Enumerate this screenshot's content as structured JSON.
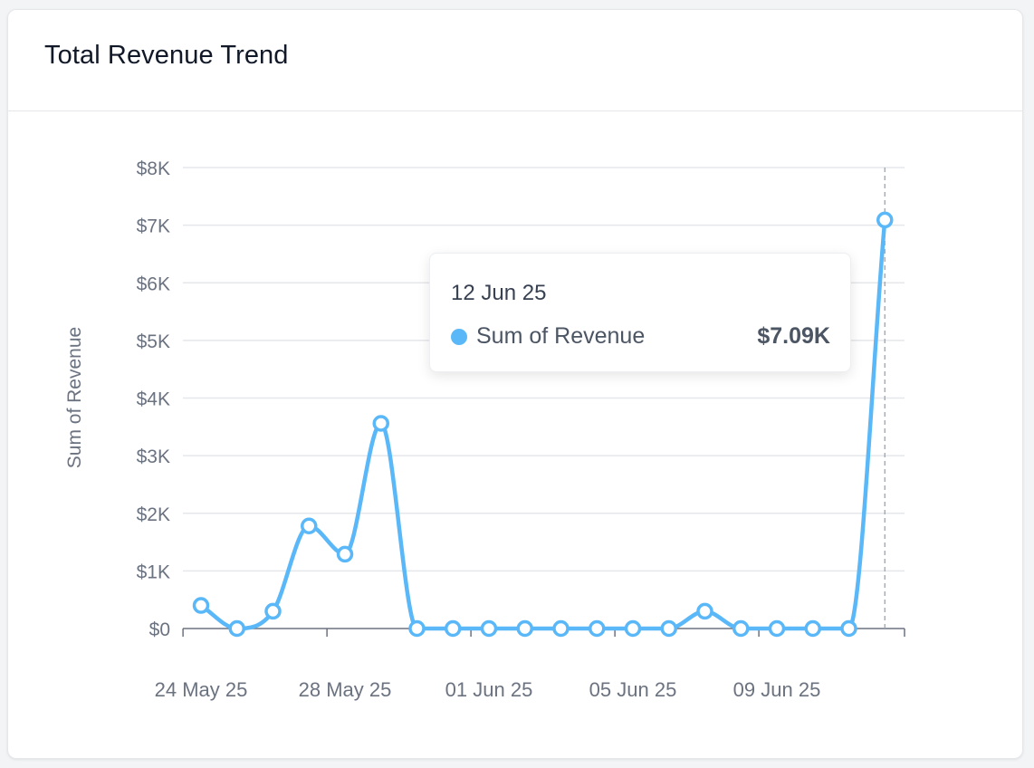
{
  "card": {
    "title": "Total Revenue Trend"
  },
  "tooltip": {
    "date": "12 Jun 25",
    "series_label": "Sum of Revenue",
    "value": "$7.09K",
    "dot_color": "#5ab8f8"
  },
  "colors": {
    "line": "#5ab8f8",
    "grid": "#e5e7eb",
    "axis": "#6b7280",
    "tick_text": "#6b7280",
    "crosshair": "#9ca3af"
  },
  "chart_data": {
    "type": "line",
    "title": "",
    "ylabel": "Sum of Revenue",
    "xlabel": "",
    "ylim": [
      0,
      8000
    ],
    "y_ticks": [
      0,
      1000,
      2000,
      3000,
      4000,
      5000,
      6000,
      7000,
      8000
    ],
    "y_tick_labels": [
      "$0",
      "$1K",
      "$2K",
      "$3K",
      "$4K",
      "$5K",
      "$6K",
      "$7K",
      "$8K"
    ],
    "x_tick_labels": [
      "24 May 25",
      "28 May 25",
      "01 Jun 25",
      "05 Jun 25",
      "09 Jun 25"
    ],
    "x_tick_dates": [
      "24 May 25",
      "28 May 25",
      "01 Jun 25",
      "05 Jun 25",
      "09 Jun 25"
    ],
    "grid": true,
    "smooth": true,
    "hovered_index": 19,
    "series": [
      {
        "name": "Sum of Revenue",
        "color": "#5ab8f8",
        "x": [
          "24 May 25",
          "25 May 25",
          "26 May 25",
          "27 May 25",
          "28 May 25",
          "29 May 25",
          "30 May 25",
          "31 May 25",
          "01 Jun 25",
          "02 Jun 25",
          "03 Jun 25",
          "04 Jun 25",
          "05 Jun 25",
          "06 Jun 25",
          "07 Jun 25",
          "08 Jun 25",
          "09 Jun 25",
          "10 Jun 25",
          "11 Jun 25",
          "12 Jun 25"
        ],
        "values": [
          400,
          0,
          300,
          1780,
          1290,
          3560,
          0,
          0,
          0,
          0,
          0,
          0,
          0,
          0,
          300,
          0,
          0,
          0,
          0,
          7090
        ]
      }
    ]
  }
}
